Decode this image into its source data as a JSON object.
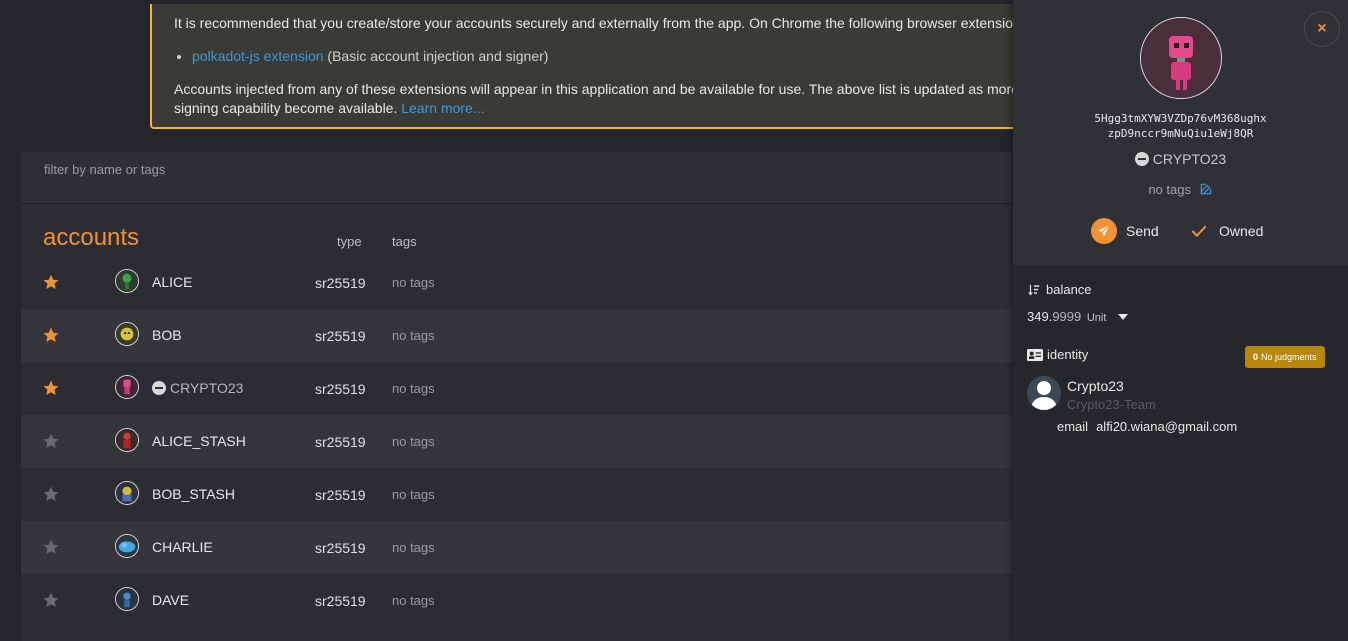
{
  "banner": {
    "line1": "It is recommended that you create/store your accounts securely and externally from the app. On Chrome the following browser extensio",
    "ext_link": "polkadot-js extension",
    "ext_desc": "(Basic account injection and signer)",
    "line2": "Accounts injected from any of these extensions will appear in this application and be available for use. The above list is updated as more",
    "line3": "signing capability become available.",
    "learn_more": "Learn more..."
  },
  "filter": {
    "placeholder": "filter by name or tags"
  },
  "table": {
    "title": "accounts",
    "col_type": "type",
    "col_tags": "tags",
    "rows": [
      {
        "name": "ALICE",
        "type": "sr25519",
        "tags": "no tags",
        "favorite": true
      },
      {
        "name": "BOB",
        "type": "sr25519",
        "tags": "no tags",
        "favorite": true
      },
      {
        "name": "CRYPTO23",
        "type": "sr25519",
        "tags": "no tags",
        "favorite": true
      },
      {
        "name": "ALICE_STASH",
        "type": "sr25519",
        "tags": "no tags",
        "favorite": false
      },
      {
        "name": "BOB_STASH",
        "type": "sr25519",
        "tags": "no tags",
        "favorite": false
      },
      {
        "name": "CHARLIE",
        "type": "sr25519",
        "tags": "no tags",
        "favorite": false
      },
      {
        "name": "DAVE",
        "type": "sr25519",
        "tags": "no tags",
        "favorite": false
      }
    ]
  },
  "sidebar": {
    "close": "×",
    "address_line1": "5Hgg3tmXYW3VZDp76vM368ughx",
    "address_line2": "zpD9nccr9mNuQiu1eWj8QR",
    "name": "CRYPTO23",
    "tags": "no tags",
    "send_label": "Send",
    "owned_label": "Owned",
    "balance_label": "balance",
    "balance_int": "349.",
    "balance_dec": "9999",
    "balance_unit": "Unit",
    "identity_label": "identity",
    "judgment_count": "0",
    "judgment_label": "No judgments",
    "id_name": "Crypto23",
    "id_team": "Crypto23-Team",
    "email_key": "email",
    "email_value": "alfi20.wiana@gmail.com"
  },
  "colors": {
    "accent": "#f19135",
    "banner_border": "#f5b331",
    "link": "#3f97d6",
    "star_active": "#f19135",
    "star_inactive": "#6b6c72",
    "judgment_bg": "#b8860b"
  }
}
